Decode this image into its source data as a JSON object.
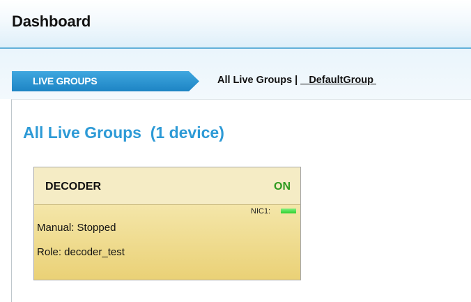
{
  "header": {
    "title": "Dashboard"
  },
  "tabs": {
    "live_groups_label": "LIVE GROUPS"
  },
  "breadcrumb": {
    "all_live_groups": "All Live Groups",
    "separator": "|",
    "default_group": " _DefaultGroup "
  },
  "main": {
    "title": "All Live Groups  (1 device)"
  },
  "device": {
    "name": "DECODER",
    "status": "ON",
    "status_color": "#2e9a1f",
    "nic_label": "NIC1:",
    "nic_color": "#2fcf2f",
    "mode": "Manual: Stopped",
    "role": "Role: decoder_test"
  },
  "colors": {
    "accent": "#2d9ad6",
    "card_background": "#eed98b"
  }
}
